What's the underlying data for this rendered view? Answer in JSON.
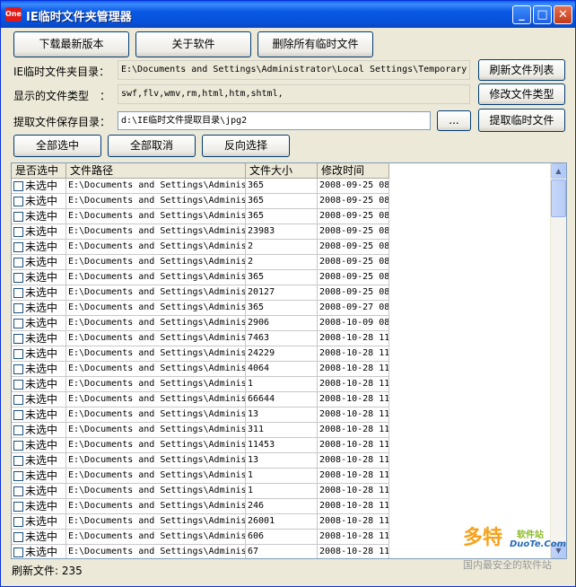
{
  "window": {
    "title": "IE临时文件夹管理器",
    "app_icon_text": "One",
    "controls": {
      "minimize": "_",
      "maximize": "□",
      "close": "✕"
    }
  },
  "toolbar": {
    "download_latest": "下载最新版本",
    "about": "关于软件",
    "delete_all": "删除所有临时文件"
  },
  "form": {
    "temp_dir_label": "IE临时文件夹目录：",
    "temp_dir_value": "E:\\Documents and Settings\\Administrator\\Local Settings\\Temporary",
    "refresh_list": "刷新文件列表",
    "file_types_label": "显示的文件类型　：",
    "file_types_value": "swf,flv,wmv,rm,html,htm,shtml,",
    "modify_types": "修改文件类型",
    "save_dir_label": "提取文件保存目录：",
    "save_dir_value": "d:\\IE临时文件提取目录\\jpg2",
    "browse": "...",
    "extract": "提取临时文件"
  },
  "selection": {
    "select_all": "全部选中",
    "deselect_all": "全部取消",
    "invert": "反向选择"
  },
  "table": {
    "headers": [
      "是否选中",
      "文件路径",
      "文件大小",
      "修改时间"
    ],
    "check_label": "未选中",
    "path": "E:\\Documents and Settings\\Adminis",
    "rows": [
      {
        "size": "365",
        "time": "2008-09-25 08"
      },
      {
        "size": "365",
        "time": "2008-09-25 08"
      },
      {
        "size": "365",
        "time": "2008-09-25 08"
      },
      {
        "size": "23983",
        "time": "2008-09-25 08"
      },
      {
        "size": "2",
        "time": "2008-09-25 08"
      },
      {
        "size": "2",
        "time": "2008-09-25 08"
      },
      {
        "size": "365",
        "time": "2008-09-25 08"
      },
      {
        "size": "20127",
        "time": "2008-09-25 08"
      },
      {
        "size": "365",
        "time": "2008-09-27 08"
      },
      {
        "size": "2906",
        "time": "2008-10-09 08"
      },
      {
        "size": "7463",
        "time": "2008-10-28 11"
      },
      {
        "size": "24229",
        "time": "2008-10-28 11"
      },
      {
        "size": "4064",
        "time": "2008-10-28 11"
      },
      {
        "size": "1",
        "time": "2008-10-28 11"
      },
      {
        "size": "66644",
        "time": "2008-10-28 11"
      },
      {
        "size": "13",
        "time": "2008-10-28 11"
      },
      {
        "size": "311",
        "time": "2008-10-28 11"
      },
      {
        "size": "11453",
        "time": "2008-10-28 11"
      },
      {
        "size": "13",
        "time": "2008-10-28 11"
      },
      {
        "size": "1",
        "time": "2008-10-28 11"
      },
      {
        "size": "1",
        "time": "2008-10-28 11"
      },
      {
        "size": "246",
        "time": "2008-10-28 11"
      },
      {
        "size": "26001",
        "time": "2008-10-28 11"
      },
      {
        "size": "606",
        "time": "2008-10-28 11"
      },
      {
        "size": "67",
        "time": "2008-10-28 11"
      }
    ]
  },
  "status": {
    "text": "刷新文件: 235"
  },
  "watermark": {
    "logo": "多特",
    "sub": "软件站",
    "url": "DuoTe.Com",
    "footer": "国内最安全的软件站"
  }
}
